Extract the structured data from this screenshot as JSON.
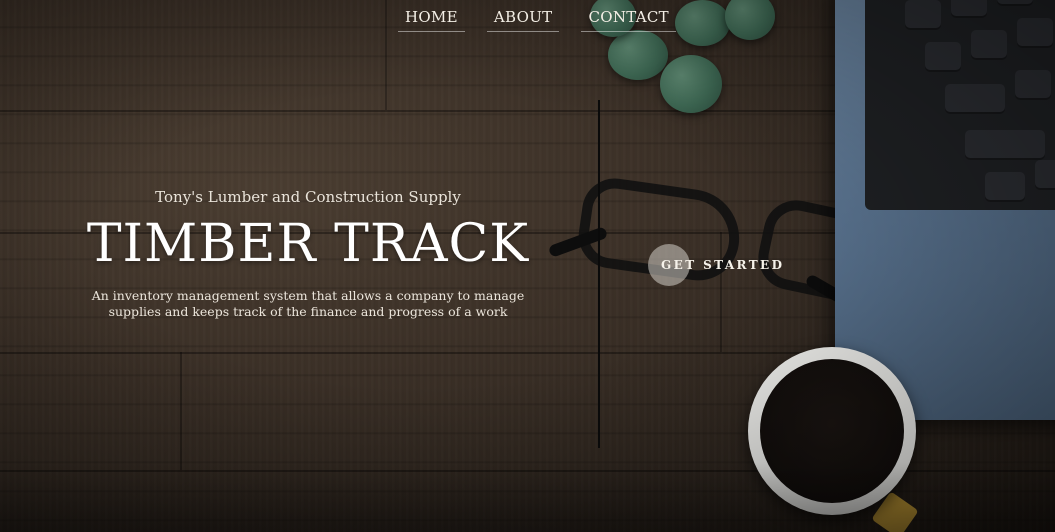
{
  "nav": {
    "items": [
      {
        "label": "HOME"
      },
      {
        "label": "ABOUT"
      },
      {
        "label": "CONTACT"
      }
    ]
  },
  "hero": {
    "company": "Tony's Lumber and Construction Supply",
    "title": "TIMBER TRACK",
    "description": "An inventory management system that allows a company to manage supplies and keeps track of the finance and progress of a work",
    "cta_label": "GET STARTED"
  },
  "colors": {
    "wood_background": "#3a2f26",
    "text": "#ffffff",
    "laptop": "#5b7592",
    "plant": "#3f6a55",
    "mug_handle": "#d5a93b"
  }
}
